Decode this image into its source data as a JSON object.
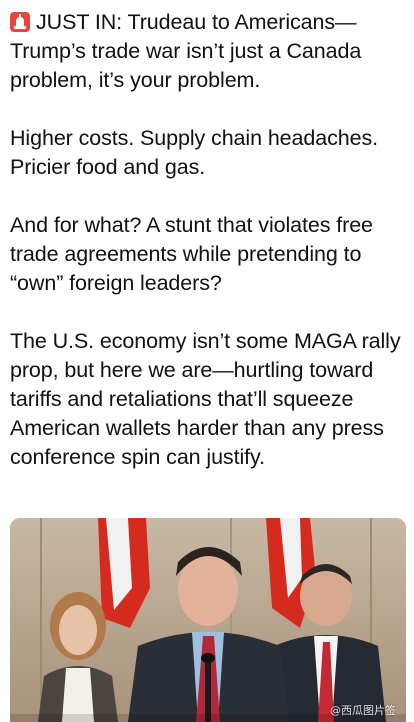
{
  "post": {
    "icon": "siren-icon",
    "paragraphs": [
      {
        "prefix": "JUST IN: ",
        "text": "Trudeau to Americans—Trump’s trade war isn’t just a Canada problem, it’s your problem."
      },
      {
        "text": "Higher costs. Supply chain headaches. Pricier food and gas."
      },
      {
        "text": "And for what? A stunt that violates free trade agreements while pretending to “own” foreign leaders?"
      },
      {
        "text": "The U.S. economy isn’t some MAGA rally prop, but here we are—hurtling toward tariffs and retaliations that’ll squeeze American wallets harder than any press conference spin can justify."
      }
    ]
  },
  "photo": {
    "subject": "press-conference-photo",
    "watermark": "@西瓜图片签",
    "colors": {
      "wall": "#b9a792",
      "flag_red": "#d52b1e",
      "suit": "#2a2e36"
    }
  }
}
